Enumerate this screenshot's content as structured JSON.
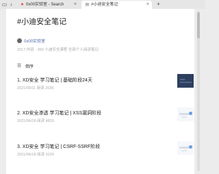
{
  "browser": {
    "tabs": [
      {
        "label": "0x00实验室 - Search",
        "active": false,
        "icon": "search-favicon"
      },
      {
        "label": "#小迪安全笔记",
        "active": true,
        "icon": "page-favicon"
      }
    ],
    "close_glyph": "×",
    "new_tab_glyph": "+"
  },
  "page": {
    "title": "#小迪安全笔记",
    "author": "0x00实验室",
    "meta": "2017 内容 · 360 小迪安全课程 全部个人阅读笔记",
    "toc_label": "倒序",
    "articles": [
      {
        "title": "1. XD安全 学习笔记 | 基础阶段24天",
        "meta": "2021/05/11  阅读 2036",
        "thumb": "dark",
        "thumb_text": "XinDi · eleventyhour"
      },
      {
        "title": "2. XD安全渗透 学习笔记 | XSS漏洞阶段",
        "meta": "2021/06/18  阅读 4833",
        "thumb": "light"
      },
      {
        "title": "3. XD安全 学习笔记 | CSRF-SSRF阶段",
        "meta": "2021/06/18  阅读 2029",
        "thumb": "light"
      }
    ]
  }
}
